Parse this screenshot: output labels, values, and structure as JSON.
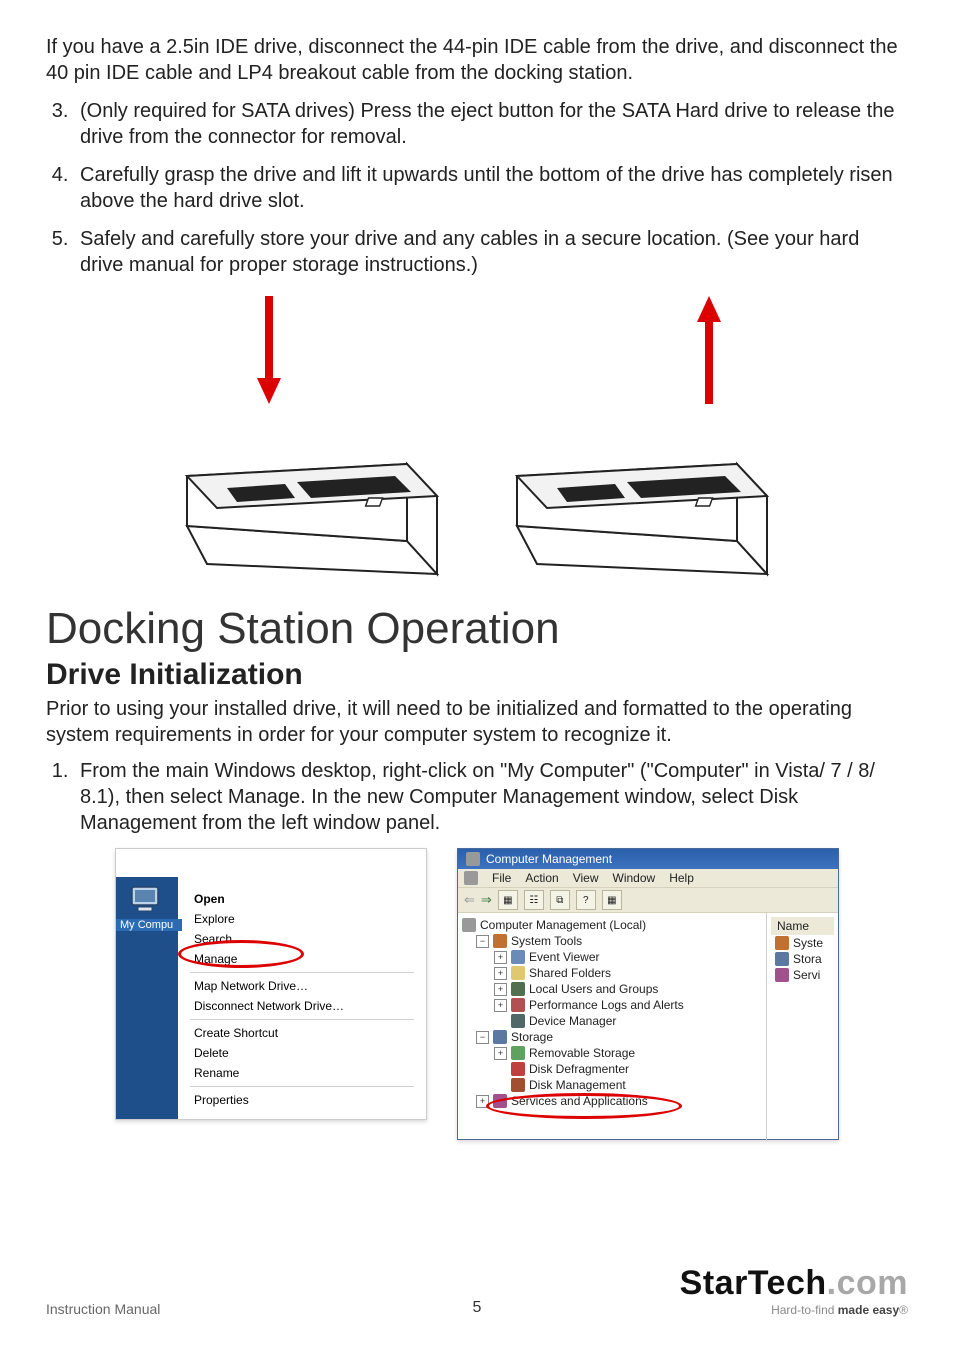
{
  "intro": "If you have a 2.5in IDE drive, disconnect the 44-pin IDE cable from the drive, and disconnect the 40 pin IDE cable and LP4 breakout cable from the docking station.",
  "steps": {
    "s3": "(Only required for SATA drives) Press the eject button for the SATA Hard drive to release the drive from the connector for removal.",
    "s4": "Carefully grasp the drive and lift it upwards until the bottom of the drive has completely risen above the hard drive slot.",
    "s5": "Safely and carefully store your drive and any cables in a secure location. (See your hard drive manual for proper storage instructions.)"
  },
  "section_heading": "Docking Station Operation",
  "subsection_heading": "Drive Initialization",
  "init_intro": "Prior to using your installed drive, it will need to be initialized and formatted to the operating system requirements in order for your computer system to recognize it.",
  "init_step1": "From the main Windows desktop, right-click on \"My Computer\" (\"Computer\" in Vista/ 7 / 8/ 8.1), then select Manage. In the new Computer Management window, select Disk Management from the left window panel.",
  "context_menu": {
    "icon_label": "My Compu",
    "items": {
      "open": "Open",
      "explore": "Explore",
      "search": "Search…",
      "manage": "Manage",
      "map": "Map Network Drive…",
      "disconnect": "Disconnect Network Drive…",
      "shortcut": "Create Shortcut",
      "delete": "Delete",
      "rename": "Rename",
      "properties": "Properties"
    }
  },
  "mgmt": {
    "title": "Computer Management",
    "menu": {
      "file": "File",
      "action": "Action",
      "view": "View",
      "window": "Window",
      "help": "Help"
    },
    "nav": {
      "back": "⇐",
      "fwd": "⇒"
    },
    "tree": {
      "root": "Computer Management (Local)",
      "system_tools": "System Tools",
      "event_viewer": "Event Viewer",
      "shared_folders": "Shared Folders",
      "local_users": "Local Users and Groups",
      "perf": "Performance Logs and Alerts",
      "device_mgr": "Device Manager",
      "storage": "Storage",
      "removable": "Removable Storage",
      "defrag": "Disk Defragmenter",
      "disk_mgmt": "Disk Management",
      "services": "Services and Applications"
    },
    "side": {
      "name": "Name",
      "syste": "Syste",
      "stora": "Stora",
      "servi": "Servi"
    }
  },
  "footer": {
    "left": "Instruction Manual",
    "page": "5",
    "brand_main_a": "StarTech",
    "brand_main_b": ".com",
    "brand_sub_a": "Hard-to-find ",
    "brand_sub_b": "made easy",
    "brand_reg": "®"
  }
}
